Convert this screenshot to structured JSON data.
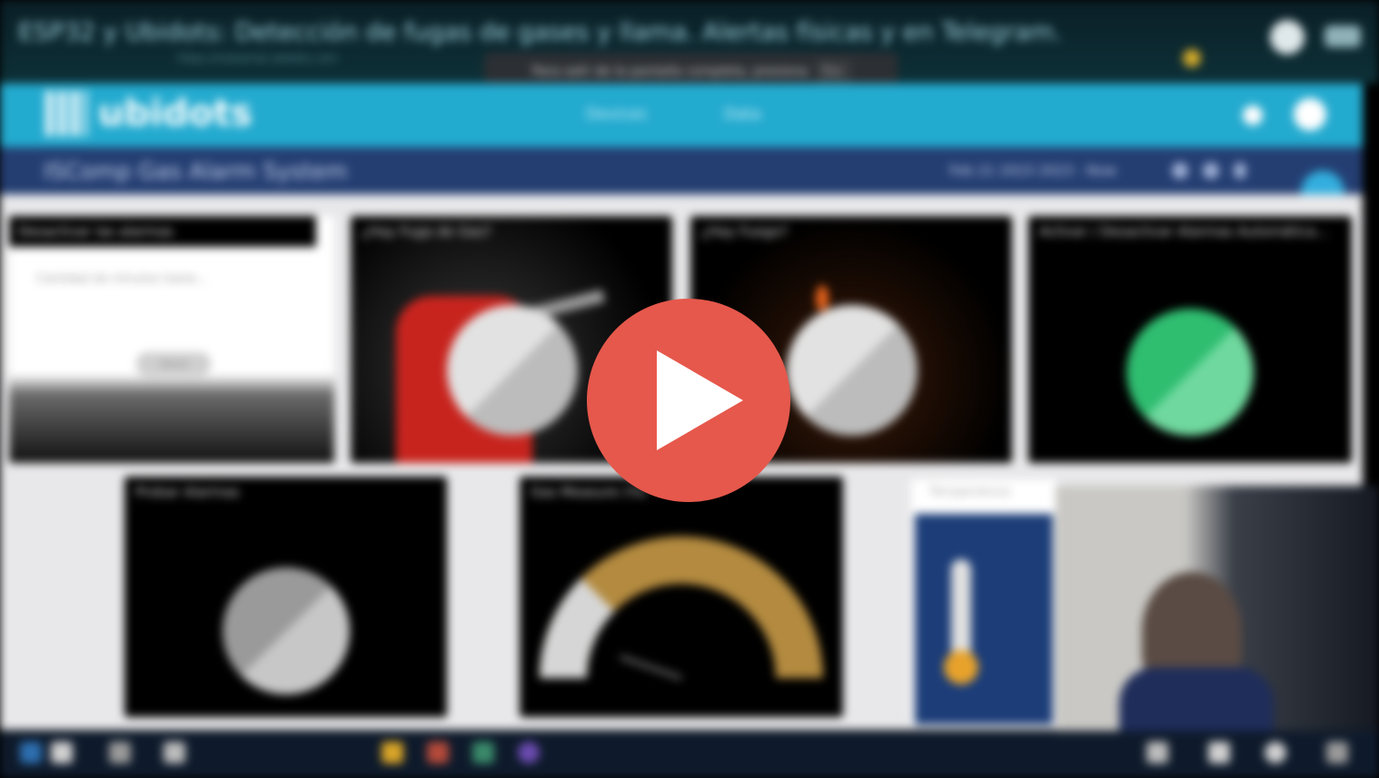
{
  "video": {
    "title": "ESP32 y Ubidots: Detección de fugas de gases y llama. Alertas físicas y en Telegram.",
    "url": "https://industrial.ubidots.com",
    "fullscreen_notice": "Para salir de la pantalla completa, presiona",
    "fullscreen_key": "Esc",
    "play_label": "Play video"
  },
  "ubidots": {
    "logo": "ubidots",
    "nav": [
      "Devices",
      "Data"
    ],
    "dashboard_title": "ISComp Gas Alarm System",
    "date_range": "Feb 21 2023 2023 - Now"
  },
  "widgets": [
    {
      "title": "Desactivar las alarmas",
      "input_label": "Cantidad de minutos hasta...",
      "button_label": "Send"
    },
    {
      "title": "¿Hay Fuga de Gas?"
    },
    {
      "title": "¿Hay Fuego?"
    },
    {
      "title": "Activar / Desactivar Alarmas Automática..."
    },
    {
      "title": "Probar Alarmas"
    },
    {
      "title": "Gas Measure (%)"
    },
    {
      "title": "Temperatura"
    }
  ],
  "gauge": {
    "value_fraction": 0.25
  },
  "colors": {
    "ubidots_header": "#23aacf",
    "dashboard_bar": "#243e72",
    "toggle_on": "#2fbd70",
    "indicator_off": "#c8c8c8",
    "play_button": "#e6584c",
    "gauge_fill": "#b38a3f"
  },
  "icons": [
    "play-icon",
    "bell-icon",
    "user-avatar-icon",
    "edit-icon",
    "settings-icon",
    "windows-start-icon"
  ]
}
